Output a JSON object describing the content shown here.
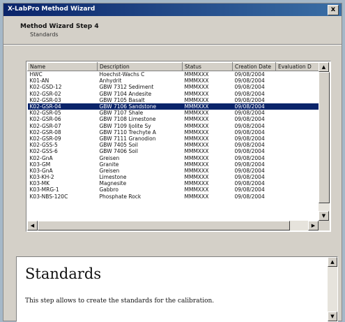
{
  "window": {
    "title": "X-LabPro Method Wizard",
    "close_label": "x"
  },
  "header": {
    "step_title": "Method Wizard Step 4",
    "step_subtitle": "Standards"
  },
  "table": {
    "columns": [
      "Name",
      "Description",
      "Status",
      "Creation Date",
      "Evaluation D"
    ],
    "rows": [
      [
        "HWC",
        "Hoechst-Wachs C",
        "MMMXXX",
        "09/08/2004",
        ""
      ],
      [
        "K01-AN",
        "Anhydrit",
        "MMMXXX",
        "09/08/2004",
        ""
      ],
      [
        "K02-GSD-12",
        "GBW 7312 Sediment",
        "MMMXXX",
        "09/08/2004",
        ""
      ],
      [
        "K02-GSR-02",
        "GBW 7104 Andesite",
        "MMMXXX",
        "09/08/2004",
        ""
      ],
      [
        "K02-GSR-03",
        "GBW 7105 Basalt",
        "MMMXXX",
        "09/08/2004",
        ""
      ],
      [
        "K02-GSR-04",
        "GBW 7106 Sandstone",
        "MMMXXX",
        "09/08/2004",
        ""
      ],
      [
        "K02-GSR-05",
        "GBW 7107 Shale",
        "MMMXXX",
        "09/08/2004",
        ""
      ],
      [
        "K02-GSR-06",
        "GBW 7108 Limestone",
        "MMMXXX",
        "09/08/2004",
        ""
      ],
      [
        "K02-GSR-07",
        "GBW 7109 Ijolite Sy",
        "MMMXXX",
        "09/08/2004",
        ""
      ],
      [
        "K02-GSR-08",
        "GBW 7110 Trechyte A",
        "MMMXXX",
        "09/08/2004",
        ""
      ],
      [
        "K02-GSR-09",
        "GBW 7111 Granodion",
        "MMMXXX",
        "09/08/2004",
        ""
      ],
      [
        "K02-GSS-5",
        "GBW 7405 Soil",
        "MMMXXX",
        "09/08/2004",
        ""
      ],
      [
        "K02-GSS-6",
        "GBW 7406 Soil",
        "MMMXXX",
        "09/08/2004",
        ""
      ],
      [
        "K02-GnA",
        "Greisen",
        "MMMXXX",
        "09/08/2004",
        ""
      ],
      [
        "K03-GM",
        "Granite",
        "MMMXXX",
        "09/08/2004",
        ""
      ],
      [
        "K03-GnA",
        "Greisen",
        "MMMXXX",
        "09/08/2004",
        ""
      ],
      [
        "K03-KH-2",
        "Limestone",
        "MMMXXX",
        "09/08/2004",
        ""
      ],
      [
        "K03-MK",
        "Magnesite",
        "MMMXXX",
        "09/08/2004",
        ""
      ],
      [
        "K03-MRG-1",
        "Gabbro",
        "MMMXXX",
        "09/08/2004",
        ""
      ],
      [
        "K03-NBS-120C",
        "Phosphate Rock",
        "MMMXXX",
        "09/08/2004",
        ""
      ]
    ],
    "selected_index": 5
  },
  "help": {
    "heading": "Standards",
    "text": "This step allows to create the standards for the calibration."
  }
}
